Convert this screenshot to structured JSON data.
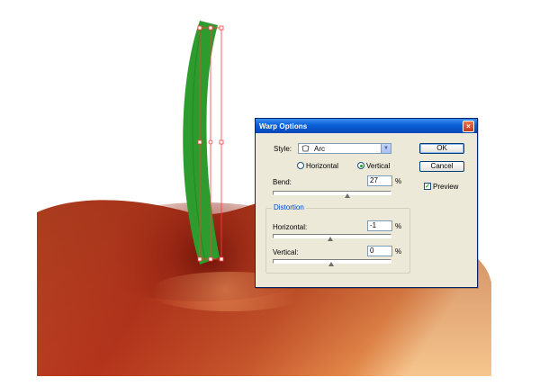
{
  "dialog": {
    "title": "Warp Options",
    "close_glyph": "×",
    "style_label": "Style:",
    "style_value": "Arc",
    "style_icon": "arc-warp-icon",
    "orientation": {
      "horizontal_label": "Horizontal",
      "vertical_label": "Vertical",
      "selected": "Vertical"
    },
    "bend": {
      "label": "Bend:",
      "value": "27",
      "unit": "%",
      "percent": 27
    },
    "distortion": {
      "legend": "Distortion",
      "horizontal": {
        "label": "Horizontal:",
        "value": "-1",
        "unit": "%",
        "percent": -1
      },
      "vertical": {
        "label": "Vertical:",
        "value": "0",
        "unit": "%",
        "percent": 0
      }
    },
    "buttons": {
      "ok": "OK",
      "cancel": "Cancel"
    },
    "preview": {
      "label": "Preview",
      "checked": true,
      "check_glyph": "✓"
    }
  },
  "colors": {
    "title_bar": "#0a5fd6",
    "dialog_face": "#ece9d8",
    "stem_green": "#2e9b2e",
    "selection_red": "#ff3b3b",
    "apple_red": "#b7361d"
  }
}
